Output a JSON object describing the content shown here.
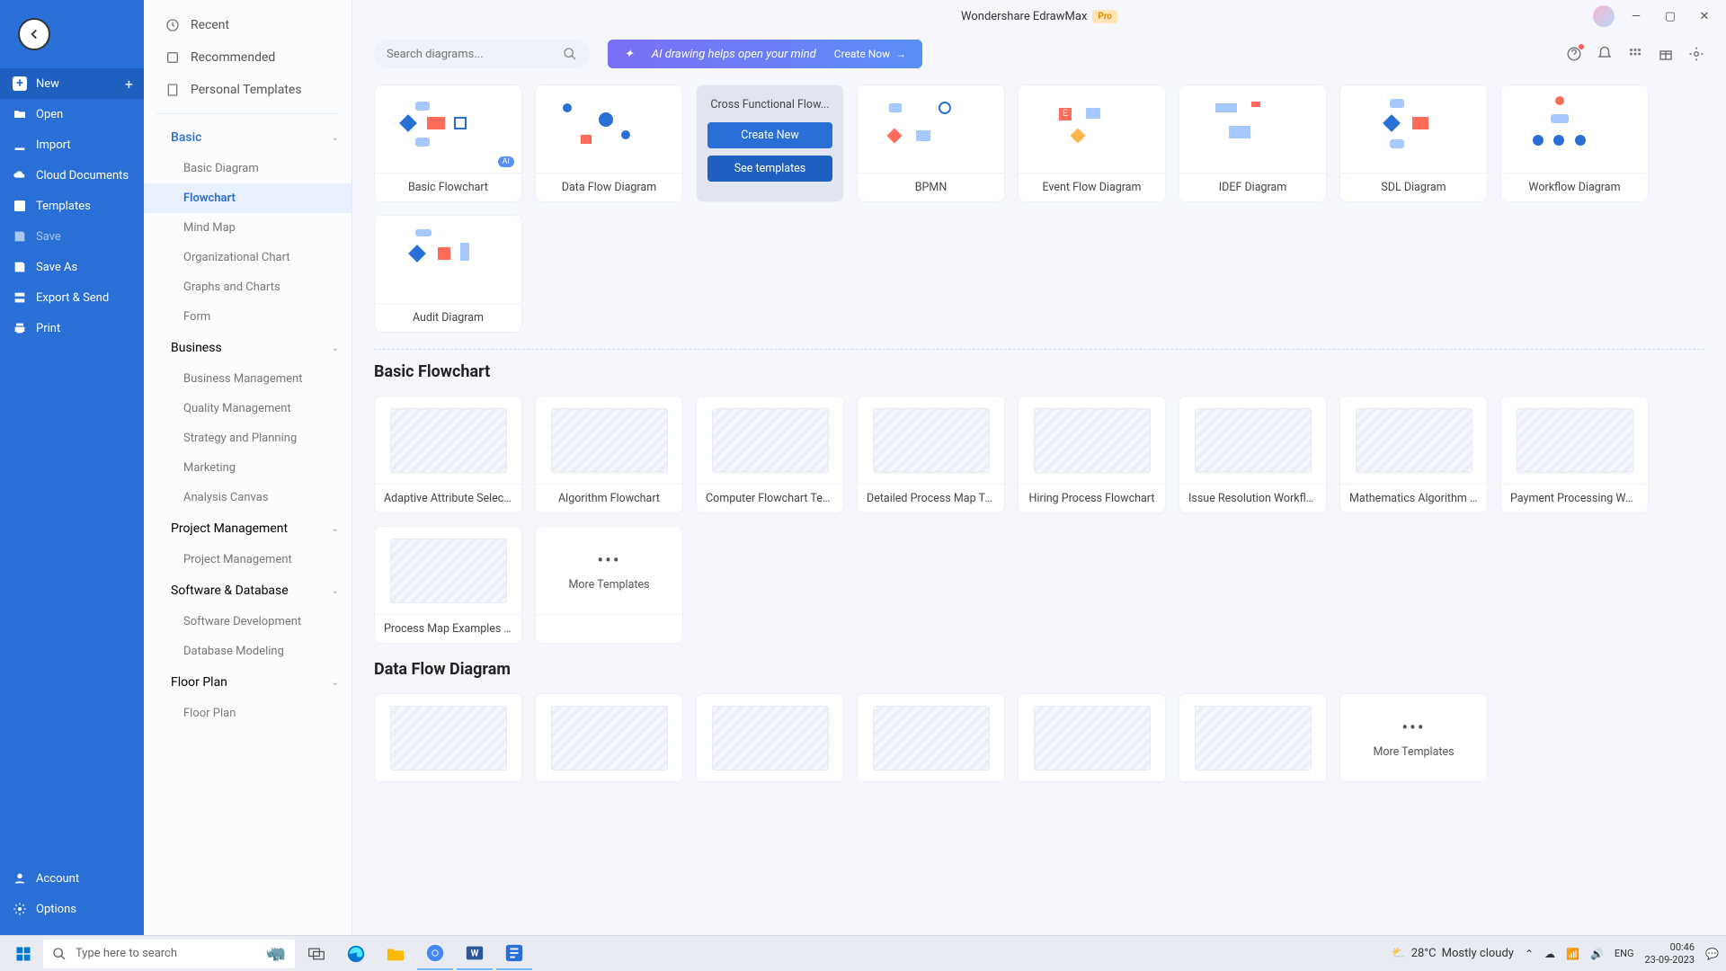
{
  "title": {
    "app": "Wondershare EdrawMax",
    "badge": "Pro"
  },
  "sidebar_left": {
    "new": "New",
    "open": "Open",
    "import": "Import",
    "cloud": "Cloud Documents",
    "templates": "Templates",
    "save": "Save",
    "saveas": "Save As",
    "export": "Export & Send",
    "print": "Print",
    "account": "Account",
    "options": "Options"
  },
  "sidebar_mid": {
    "recent": "Recent",
    "recommended": "Recommended",
    "personal": "Personal Templates",
    "cats": {
      "basic": {
        "label": "Basic",
        "items": [
          "Basic Diagram",
          "Flowchart",
          "Mind Map",
          "Organizational Chart",
          "Graphs and Charts",
          "Form"
        ]
      },
      "business": {
        "label": "Business",
        "items": [
          "Business Management",
          "Quality Management",
          "Strategy and Planning",
          "Marketing",
          "Analysis Canvas"
        ]
      },
      "pm": {
        "label": "Project Management",
        "items": [
          "Project Management"
        ]
      },
      "sw": {
        "label": "Software & Database",
        "items": [
          "Software Development",
          "Database Modeling"
        ]
      },
      "floor": {
        "label": "Floor Plan",
        "items": [
          "Floor Plan"
        ]
      }
    }
  },
  "search": {
    "placeholder": "Search diagrams..."
  },
  "ai": {
    "text": "AI drawing helps open your mind",
    "cta": "Create Now"
  },
  "diagram_types": [
    "Basic Flowchart",
    "Data Flow Diagram",
    "Cross Functional Flow...",
    "BPMN",
    "Event Flow Diagram",
    "IDEF Diagram",
    "SDL Diagram",
    "Workflow Diagram",
    "Audit Diagram"
  ],
  "hover": {
    "create": "Create New",
    "see": "See templates"
  },
  "sections": {
    "basic_flowchart": {
      "title": "Basic Flowchart",
      "items": [
        "Adaptive Attribute Selectio...",
        "Algorithm Flowchart",
        "Computer Flowchart Temp...",
        "Detailed Process Map Tem...",
        "Hiring Process Flowchart",
        "Issue Resolution Workflow ...",
        "Mathematics Algorithm Fl...",
        "Payment Processing Workf...",
        "Process Map Examples Te..."
      ],
      "more": "More Templates"
    },
    "dfd": {
      "title": "Data Flow Diagram",
      "more": "More Templates"
    }
  },
  "taskbar": {
    "search": "Type here to search",
    "weather_temp": "28°C",
    "weather_desc": "Mostly cloudy",
    "time": "00:46",
    "date": "23-09-2023"
  }
}
